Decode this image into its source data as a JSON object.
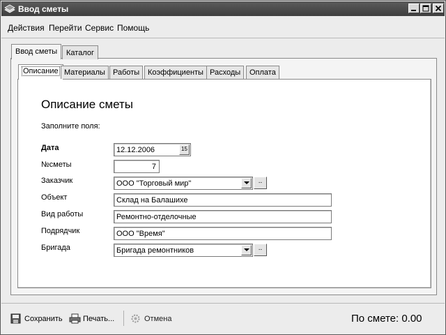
{
  "window": {
    "title": "Ввод сметы"
  },
  "menu": {
    "items": [
      "Действия",
      "Перейти",
      "Сервис",
      "Помощь"
    ]
  },
  "outer_tabs": [
    {
      "label": "Ввод сметы",
      "active": true
    },
    {
      "label": "Каталог",
      "active": false
    }
  ],
  "inner_tabs": [
    {
      "label": "Описание",
      "active": true
    },
    {
      "label": "Материалы"
    },
    {
      "label": "Работы"
    },
    {
      "label": "Коэффициенты"
    },
    {
      "label": "Расходы"
    },
    {
      "label": "Оплата"
    }
  ],
  "form": {
    "heading": "Описание сметы",
    "subtitle": "Заполните поля:",
    "date": {
      "label": "Дата",
      "value": "12.12.2006",
      "button": "15"
    },
    "number": {
      "label": "№сметы",
      "value": "7"
    },
    "customer": {
      "label": "Заказчик",
      "value": "ООО \"Торговый мир\"",
      "button": ".."
    },
    "object": {
      "label": "Объект",
      "value": "Склад на Балашихе"
    },
    "work_type": {
      "label": "Вид работы",
      "value": "Ремонтно-отделочные"
    },
    "contractor": {
      "label": "Подрядчик",
      "value": "ООО \"Время\""
    },
    "team": {
      "label": "Бригада",
      "value": "Бригада ремонтников",
      "button": ".."
    }
  },
  "toolbar": {
    "save_label": "Сохранить",
    "print_label": "Печать...",
    "cancel_label": "Отмена"
  },
  "total_text": "По смете: 0.00",
  "icons": {
    "app": "app-logo-icon",
    "minimize": "minimize-icon",
    "maximize": "maximize-icon",
    "close": "close-icon",
    "save": "floppy-disk-icon",
    "print": "printer-icon",
    "cancel": "cancel-gear-icon"
  },
  "colors": {
    "titlebar": "#4a4a4a",
    "panel": "#f4f4f4",
    "window": "#ececec"
  }
}
